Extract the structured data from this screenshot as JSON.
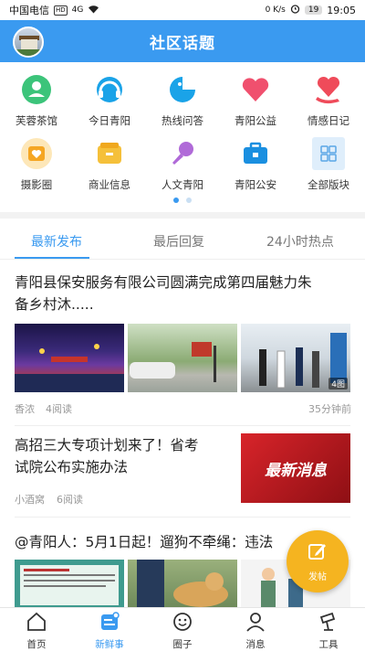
{
  "status_bar": {
    "carrier": "中国电信",
    "hd": "HD",
    "network": "4G",
    "speed": "0 K/s",
    "battery": "19",
    "time": "19:05"
  },
  "header": {
    "title": "社区话题"
  },
  "grid_items": [
    {
      "label": "芙蓉茶馆",
      "icon": "teahouse-icon",
      "color": "#3cc47a"
    },
    {
      "label": "今日青阳",
      "icon": "headset-icon",
      "color": "#1aa3e8"
    },
    {
      "label": "热线问答",
      "icon": "chat-icon",
      "color": "#1aa3e8"
    },
    {
      "label": "青阳公益",
      "icon": "heart-icon",
      "color": "#f0506e"
    },
    {
      "label": "情感日记",
      "icon": "heart-hand-icon",
      "color": "#ef4b5a"
    },
    {
      "label": "摄影圈",
      "icon": "photo-icon",
      "color": "#f5a623"
    },
    {
      "label": "商业信息",
      "icon": "wallet-icon",
      "color": "#f5c03a"
    },
    {
      "label": "人文青阳",
      "icon": "microphone-icon",
      "color": "#b06ad8"
    },
    {
      "label": "青阳公安",
      "icon": "police-bag-icon",
      "color": "#1a8fe0"
    },
    {
      "label": "全部版块",
      "icon": "grid-icon",
      "color": "#5aa6e6"
    }
  ],
  "tabs": [
    "最新发布",
    "最后回复",
    "24小时热点"
  ],
  "posts": [
    {
      "title_line1": "青阳县保安服务有限公司圆满完成第四届魅力朱",
      "title_line2": "备乡村沐.....",
      "author": "香浓",
      "reads": "4阅读",
      "time": "35分钟前",
      "image_count": "4图"
    },
    {
      "title_line1": "高招三大专项计划来了！省考",
      "title_line2": "试院公布实施办法",
      "author": "小酒窝",
      "reads": "6阅读",
      "thumb_text": "最新消息"
    },
    {
      "title_line1": "@青阳人：5月1日起！遛狗不牵绳：违法"
    }
  ],
  "fab": {
    "label": "发帖"
  },
  "bottom_nav": [
    {
      "label": "首页",
      "icon": "home-icon"
    },
    {
      "label": "新鲜事",
      "icon": "news-icon"
    },
    {
      "label": "圈子",
      "icon": "circle-icon"
    },
    {
      "label": "消息",
      "icon": "user-icon"
    },
    {
      "label": "工具",
      "icon": "tools-icon"
    }
  ]
}
